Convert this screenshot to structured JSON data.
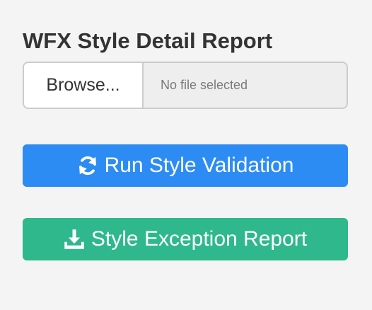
{
  "page": {
    "title": "WFX Style Detail Report"
  },
  "file_input": {
    "button_label": "Browse...",
    "status_text": "No file selected"
  },
  "run_button": {
    "label": "Run Style Validation",
    "icon": "refresh-icon",
    "color": "#2c8cf4"
  },
  "report_button": {
    "label": "Style Exception Report",
    "icon": "download-icon",
    "color": "#2eb88c"
  }
}
